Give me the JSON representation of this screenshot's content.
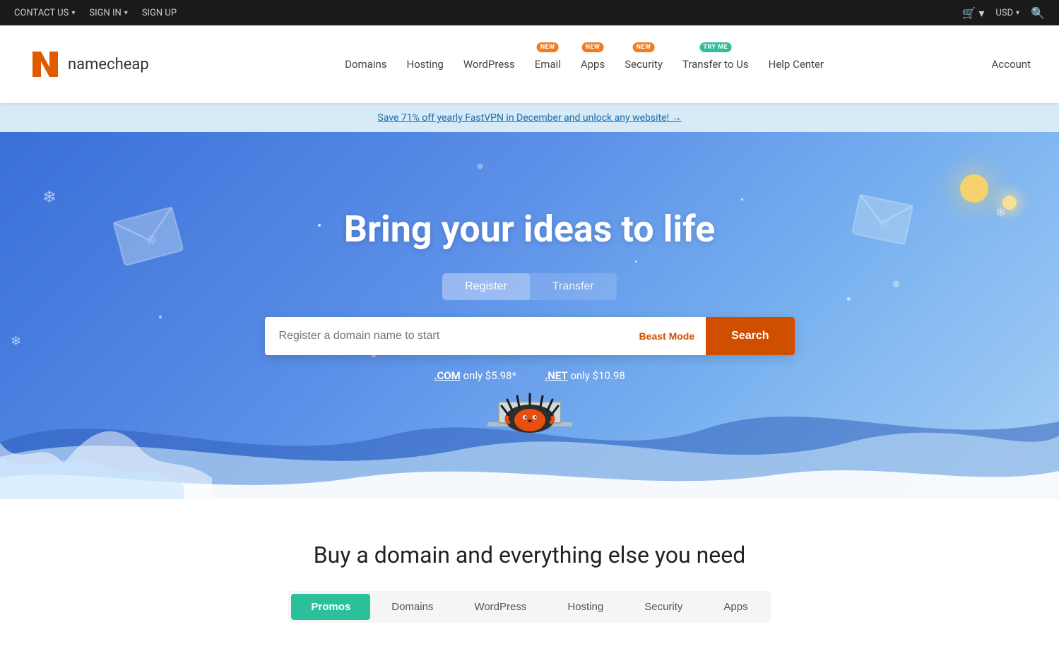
{
  "topbar": {
    "contact_us": "CONTACT US",
    "sign_in": "SIGN IN",
    "sign_up": "SIGN UP",
    "currency": "USD"
  },
  "nav": {
    "logo_text": "namecheap",
    "items": [
      {
        "label": "Domains",
        "badge": null,
        "id": "domains"
      },
      {
        "label": "Hosting",
        "badge": null,
        "id": "hosting"
      },
      {
        "label": "WordPress",
        "badge": null,
        "id": "wordpress"
      },
      {
        "label": "Email",
        "badge": "NEW",
        "id": "email"
      },
      {
        "label": "Apps",
        "badge": "NEW",
        "id": "apps"
      },
      {
        "label": "Security",
        "badge": "NEW",
        "id": "security"
      },
      {
        "label": "Transfer to Us",
        "badge": "TRY ME",
        "id": "transfer",
        "badge_type": "try-me"
      },
      {
        "label": "Help Center",
        "badge": null,
        "id": "help"
      }
    ],
    "account": "Account"
  },
  "promo_banner": {
    "text": "Save 71% off yearly FastVPN in December and unlock any website! →"
  },
  "hero": {
    "title": "Bring your ideas to life",
    "toggle": {
      "register": "Register",
      "transfer": "Transfer"
    },
    "search": {
      "placeholder": "Register a domain name to start",
      "beast_mode": "Beast Mode",
      "button": "Search"
    },
    "pricing": [
      {
        "tld": ".COM",
        "price": "only $5.98*"
      },
      {
        "tld": ".NET",
        "price": "only $10.98"
      }
    ]
  },
  "bottom": {
    "title": "Buy a domain and everything else you need",
    "tabs": [
      {
        "label": "Promos",
        "active": true
      },
      {
        "label": "Domains",
        "active": false
      },
      {
        "label": "WordPress",
        "active": false
      },
      {
        "label": "Hosting",
        "active": false
      },
      {
        "label": "Security",
        "active": false
      },
      {
        "label": "Apps",
        "active": false
      }
    ]
  }
}
